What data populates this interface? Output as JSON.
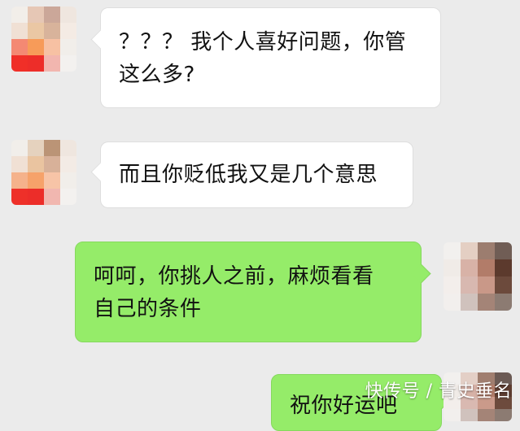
{
  "colors": {
    "background": "#ebebeb",
    "incoming_bubble": "#ffffff",
    "outgoing_bubble": "#95ec69"
  },
  "messages": [
    {
      "direction": "incoming",
      "lines": [
        "？？？ 我个人喜好问题，你管",
        "这么多?"
      ],
      "avatar_icon": "pixelated-avatar-icon"
    },
    {
      "direction": "incoming",
      "lines": [
        "而且你贬低我又是几个意思"
      ],
      "avatar_icon": "pixelated-avatar-icon"
    },
    {
      "direction": "outgoing",
      "lines": [
        "呵呵，你挑人之前，麻烦看看",
        "自己的条件"
      ],
      "avatar_icon": "pixelated-avatar-icon"
    },
    {
      "direction": "outgoing",
      "lines": [
        "祝你好运吧"
      ],
      "avatar_icon": "pixelated-avatar-icon"
    }
  ],
  "watermark": {
    "text": "快传号 / 青史垂名"
  }
}
